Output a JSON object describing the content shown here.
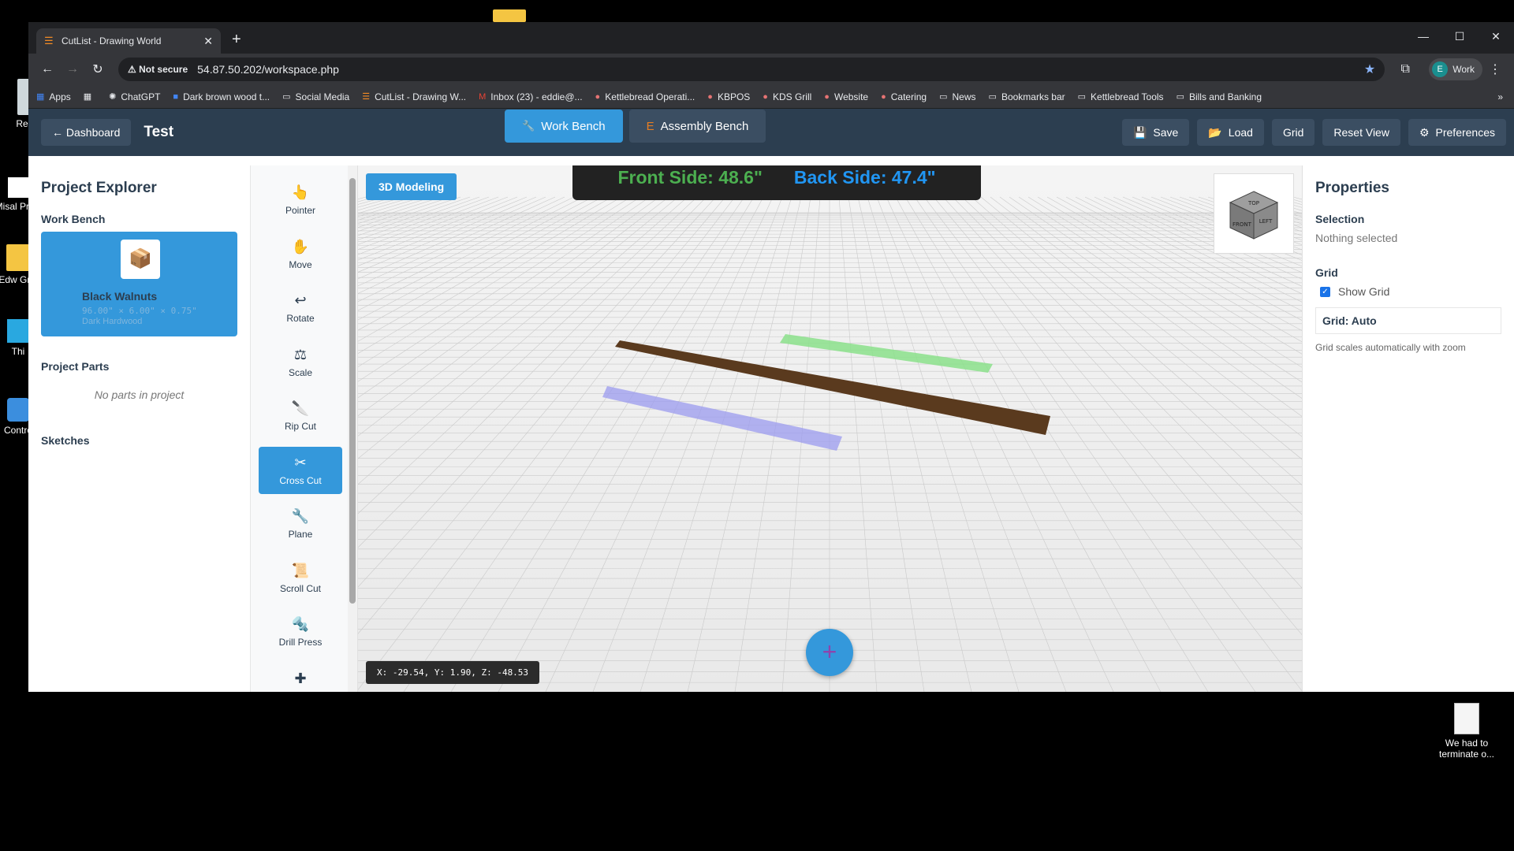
{
  "desktop": {
    "icons": [
      {
        "label": "Recyc"
      },
      {
        "label": "Misal Previ"
      },
      {
        "label": "Edw Grin"
      },
      {
        "label": "Thi"
      },
      {
        "label": "Contro"
      }
    ],
    "file_icon_label": "We had to terminate o..."
  },
  "browser": {
    "tab_title": "CutList - Drawing World",
    "security_label": "Not secure",
    "url": "54.87.50.202/workspace.php",
    "profile_initial": "E",
    "profile_label": "Work",
    "bookmarks": [
      "Apps",
      "ChatGPT",
      "Dark brown wood t...",
      "Social Media",
      "CutList - Drawing W...",
      "Inbox (23) - eddie@...",
      "Kettlebread Operati...",
      "KBPOS",
      "KDS Grill",
      "Website",
      "Catering",
      "News",
      "Bookmarks bar",
      "Kettlebread Tools",
      "Bills and Banking"
    ]
  },
  "header": {
    "dashboard_label": "← Dashboard",
    "project_name": "Test",
    "workbench_label": "Work Bench",
    "assembly_label": "Assembly Bench",
    "save_label": "Save",
    "load_label": "Load",
    "grid_label": "Grid",
    "reset_label": "Reset View",
    "prefs_label": "Preferences"
  },
  "explorer": {
    "title": "Project Explorer",
    "workbench_section": "Work Bench",
    "board_name": "Black Walnuts",
    "board_dims": "96.00\" × 6.00\" × 0.75\"",
    "board_species": "Dark Hardwood",
    "parts_section": "Project Parts",
    "no_parts": "No parts in project",
    "sketches_section": "Sketches"
  },
  "tools": [
    {
      "label": "Pointer",
      "icon": "pointer-hand-icon",
      "glyph": "👆"
    },
    {
      "label": "Move",
      "icon": "hand-icon",
      "glyph": "✋"
    },
    {
      "label": "Rotate",
      "icon": "rotate-icon",
      "glyph": "↩"
    },
    {
      "label": "Scale",
      "icon": "scale-icon",
      "glyph": "⚖"
    },
    {
      "label": "Rip Cut",
      "icon": "saw-icon",
      "glyph": "🔪"
    },
    {
      "label": "Cross Cut",
      "icon": "scissors-icon",
      "glyph": "✂"
    },
    {
      "label": "Plane",
      "icon": "wrench-icon",
      "glyph": "🔧"
    },
    {
      "label": "Scroll Cut",
      "icon": "scroll-icon",
      "glyph": "📜"
    },
    {
      "label": "Drill Press",
      "icon": "drill-icon",
      "glyph": "🔩"
    },
    {
      "label": "",
      "icon": "puzzle-icon",
      "glyph": "✚"
    }
  ],
  "active_tool": "Cross Cut",
  "viewport": {
    "mode_label": "3D Modeling",
    "front_side": "Front Side: 48.6\"",
    "back_side": "Back Side: 47.4\"",
    "coords": "X: -29.54, Y: 1.90, Z: -48.53",
    "add_label": "+",
    "cube_faces": {
      "top": "TOP",
      "front": "FRONT",
      "left": "LEFT"
    }
  },
  "properties": {
    "title": "Properties",
    "selection_label": "Selection",
    "selection_value": "Nothing selected",
    "grid_label": "Grid",
    "show_grid_label": "Show Grid",
    "show_grid_checked": true,
    "grid_mode": "Grid: Auto",
    "grid_note": "Grid scales automatically with zoom"
  },
  "colors": {
    "header_bg": "#2c3e50",
    "accent": "#3498db",
    "board_dark": "#5a3a1e",
    "board_green": "#8be08b",
    "board_blue": "#9b9bef",
    "front_text": "#4caf50",
    "back_text": "#2196f3"
  }
}
